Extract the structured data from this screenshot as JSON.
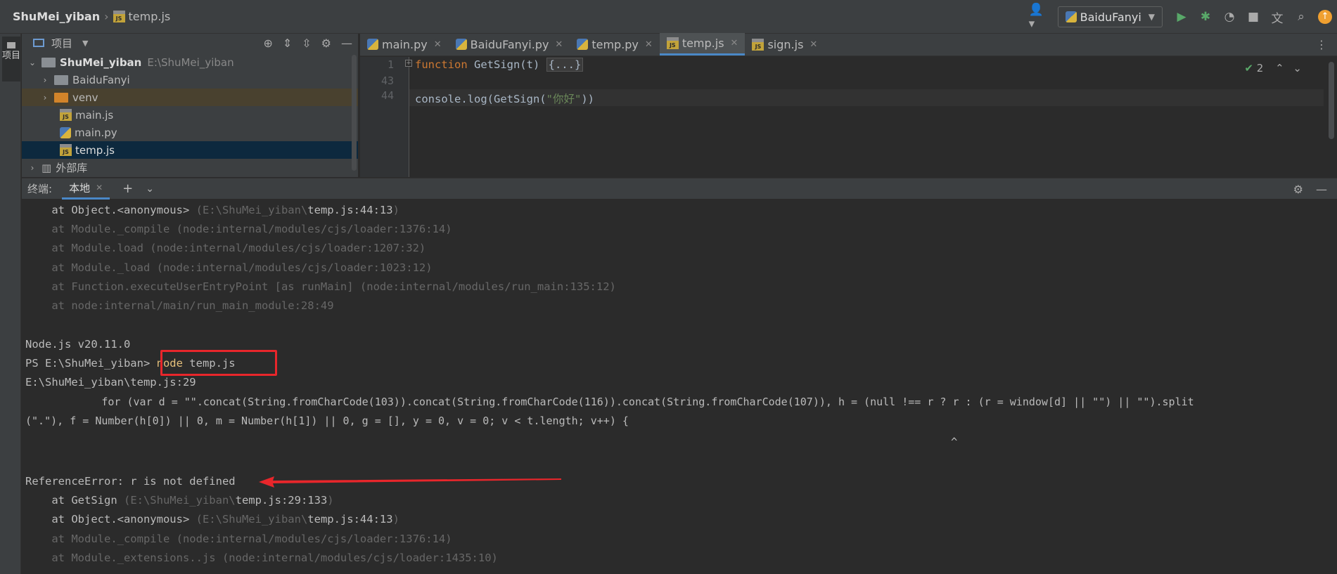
{
  "titlebar": {
    "project": "ShuMei_yiban",
    "file": "temp.js",
    "run_config": "BaiduFanyi"
  },
  "left_strip": {
    "project_tab": "项目"
  },
  "project_panel": {
    "header": "项目",
    "tree": [
      {
        "label": "ShuMei_yiban",
        "path": "E:\\ShuMei_yiban",
        "kind": "root"
      },
      {
        "label": "BaiduFanyi",
        "kind": "folder"
      },
      {
        "label": "venv",
        "kind": "folder-excluded"
      },
      {
        "label": "main.js",
        "kind": "js"
      },
      {
        "label": "main.py",
        "kind": "py"
      },
      {
        "label": "temp.js",
        "kind": "js",
        "selected": true
      },
      {
        "label": "外部库",
        "kind": "lib"
      }
    ]
  },
  "editor": {
    "tabs": [
      {
        "label": "main.py",
        "kind": "py"
      },
      {
        "label": "BaiduFanyi.py",
        "kind": "py"
      },
      {
        "label": "temp.py",
        "kind": "py"
      },
      {
        "label": "temp.js",
        "kind": "js",
        "active": true
      },
      {
        "label": "sign.js",
        "kind": "js"
      }
    ],
    "line_numbers": [
      "1",
      "43",
      "44"
    ],
    "code": {
      "l1_kw": "function",
      "l1_rest": " GetSign(t) ",
      "l1_fold": "{...}",
      "l44_a": "console.log(GetSign(",
      "l44_str": "\"你好\"",
      "l44_b": "))"
    },
    "inspections": "2"
  },
  "terminal": {
    "label": "终端:",
    "tab": "本地",
    "lines": {
      "a1": "    at Object.<anonymous> ",
      "a1p1": "(E:\\ShuMei_yiban\\",
      "a1f": "temp.js:44:13",
      "a1p2": ")",
      "a2": "    at Module._compile (node:internal/modules/cjs/loader:1376:14)",
      "a3": "    at Module.load (node:internal/modules/cjs/loader:1207:32)",
      "a4": "    at Module._load (node:internal/modules/cjs/loader:1023:12)",
      "a5": "    at Function.executeUserEntryPoint [as runMain] (node:internal/modules/run_main:135:12)",
      "a6": "    at node:internal/main/run_main_module:28:49",
      "ver": "Node.js v20.11.0",
      "prompt": "PS E:\\ShuMei_yiban> ",
      "cmd_kw": "node",
      "cmd_arg": " temp.js",
      "loc": "E:\\ShuMei_yiban\\temp.js:29",
      "src1": "            for (var d = \"\".concat(String.fromCharCode(103)).concat(String.fromCharCode(116)).concat(String.fromCharCode(107)), h = (null !== r ? r : (r = window[d] || \"\") || \"\").split",
      "src2": "(\".\"), f = Number(h[0]) || 0, m = Number(h[1]) || 0, g = [], y = 0, v = 0; v < t.length; v++) {",
      "caret": "^",
      "err": "ReferenceError: r is not defined",
      "b1": "    at GetSign ",
      "b1p1": "(E:\\ShuMei_yiban\\",
      "b1f": "temp.js:29:133",
      "b1p2": ")",
      "b2": "    at Object.<anonymous> ",
      "b2p1": "(E:\\ShuMei_yiban\\",
      "b2f": "temp.js:44:13",
      "b2p2": ")",
      "b3": "    at Module._compile (node:internal/modules/cjs/loader:1376:14)",
      "b4": "    at Module._extensions..js (node:internal/modules/cjs/loader:1435:10)"
    }
  },
  "colors": {
    "annotation": "#e8262b",
    "accent": "#4a88c7",
    "selected": "#0d293e"
  }
}
